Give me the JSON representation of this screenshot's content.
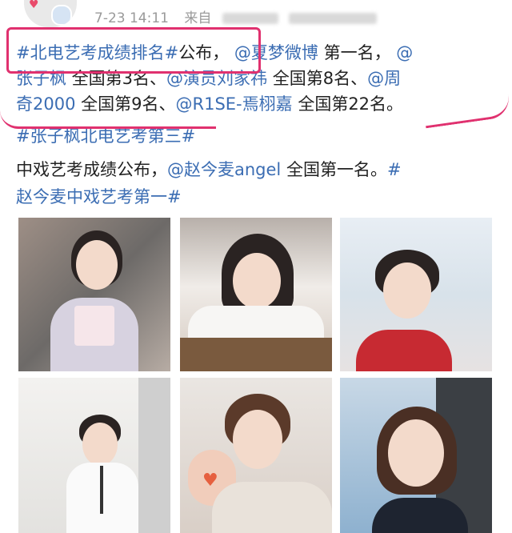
{
  "header": {
    "avatar_icon": "avatar",
    "timestamp": "7-23 14:11",
    "source_prefix": "来自"
  },
  "post": {
    "line1": {
      "hashtag": "#北电艺考成绩排名#",
      "text1": "公布，",
      "mention": "@夏梦微博",
      "text2": " 第一名，",
      "mention2": "@"
    },
    "line2": {
      "mention": "张子枫",
      "text1": " 全国第3名、",
      "mention2": "@演员刘家祎",
      "text2": " 全国第8名、",
      "mention3": "@周"
    },
    "line3": {
      "mention": "奇2000",
      "text1": " 全国第9名、",
      "mention2": "@R1SE-焉栩嘉",
      "text2": " 全国第22名。"
    },
    "line4": {
      "hashtag": "#张子枫北电艺考第三#"
    },
    "line5": {
      "text1": "中戏艺考成绩公布，",
      "mention": "@赵今麦angel",
      "text2": " 全国第一名。",
      "hashtag": "#"
    },
    "line6": {
      "hashtag": "赵今麦中戏艺考第一#"
    }
  },
  "colors": {
    "link": "#3b6db3",
    "annotation": "#e0316f",
    "text": "#222222",
    "meta": "#9a9a9a"
  },
  "photos": [
    {
      "name": "photo-1"
    },
    {
      "name": "photo-2"
    },
    {
      "name": "photo-3"
    },
    {
      "name": "photo-4"
    },
    {
      "name": "photo-5"
    },
    {
      "name": "photo-6"
    }
  ]
}
